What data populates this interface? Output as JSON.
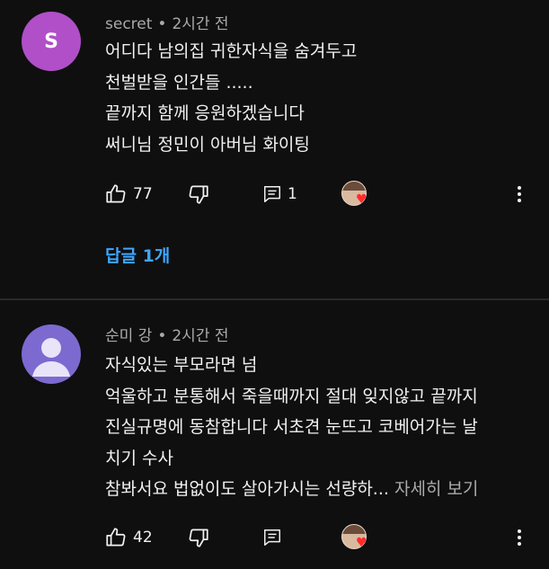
{
  "comments": [
    {
      "avatar_letter": "S",
      "avatar_color": "#b04fc8",
      "author": "secret",
      "time": "2시간 전",
      "lines": [
        "어디다 남의집 귀한자식을 숨겨두고",
        "천벌받을 인간들 .....",
        "끝까지 함께 응원하겠습니다",
        "써니님 정민이 아버님 화이팅"
      ],
      "likes": "77",
      "reply_count": "1",
      "replies_link": "답글 1개"
    },
    {
      "avatar_color": "#7c6ad0",
      "author": "순미 강",
      "time": "2시간 전",
      "lines": [
        "자식있는 부모라면 넘",
        "억울하고 분통해서 죽을때까지 절대 잊지않고 끝까지",
        "진실규명에 동참합니다 서초견 눈뜨고 코베어가는 날",
        "치기 수사",
        "참봐서요 법없이도 살아가시는 선량하..."
      ],
      "read_more": "자세히 보기",
      "likes": "42"
    }
  ],
  "separator": "•",
  "colors": {
    "background": "#0f0f0f",
    "text": "#f1f1f1",
    "secondary_text": "#aaaaaa",
    "link": "#3ea6ff",
    "heart": "#ff2b2b"
  },
  "icons": [
    "thumbs-up-icon",
    "thumbs-down-icon",
    "reply-icon",
    "creator-heart-icon",
    "more-vert-icon"
  ]
}
